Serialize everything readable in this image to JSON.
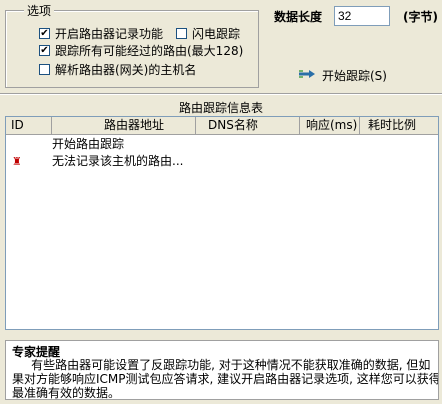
{
  "options": {
    "title": "选项",
    "record_route": {
      "label": "开启路由器记录功能",
      "checked": true
    },
    "flash_trace": {
      "label": "闪电跟踪",
      "checked": false
    },
    "trace_all": {
      "label": "跟踪所有可能经过的路由(最大128)",
      "checked": true
    },
    "resolve_names": {
      "label": "解析路由器(网关)的主机名",
      "checked": false
    }
  },
  "data_length": {
    "label": "数据长度",
    "value": "32",
    "unit": "(字节)"
  },
  "start_button": {
    "label": "开始跟踪(S)",
    "icon": "arrow-right-icon"
  },
  "table": {
    "title": "路由跟踪信息表",
    "columns": [
      "ID",
      "路由器地址",
      "DNS名称",
      "响应(ms)",
      "耗时比例"
    ],
    "rows": [
      {
        "icon": "",
        "text": "开始路由跟踪"
      },
      {
        "icon": "error-flag-icon",
        "text": "无法记录该主机的路由..."
      }
    ]
  },
  "expert": {
    "title": "专家提醒",
    "lines": [
      "     有些路由器可能设置了反跟踪功能, 对于这种情况不能获取准确的数据, 但如",
      "果对方能够响应ICMP测试包应答请求, 建议开启路由器记录选项, 这样您可以获得",
      "最准确有效的数据。"
    ]
  }
}
